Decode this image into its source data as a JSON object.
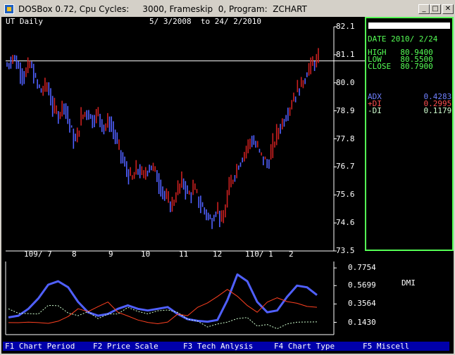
{
  "window": {
    "title": "DOSBox 0.72, Cpu Cycles:     3000, Frameskip  0, Program:  ZCHART",
    "buttons": {
      "minimize": "_",
      "maximize": "□",
      "close": "✕"
    }
  },
  "chart_header": {
    "symbol": "UT Daily",
    "range": "5/ 3/2008  to 24/ 2/2010"
  },
  "info_panel": {
    "date": "DATE 2010/ 2/24",
    "high": "HIGH   80.9400",
    "low": "LOW    80.5500",
    "close": "CLOSE  80.7900",
    "adx": "ADX         0.4283",
    "pdi": "+DI         0.2995",
    "mdi": "-DI         0.1179"
  },
  "colors": {
    "up": "#cc2020",
    "down": "#5060ff",
    "adx": "#5060ff",
    "pdi": "#ff4020",
    "mdi": "#d0ffd0",
    "panel_border": "#55ff55"
  },
  "chart_data": [
    {
      "type": "candlestick",
      "title": "UT Daily",
      "x_range": [
        "2008-03-05",
        "2010-02-24"
      ],
      "x_tick_labels": [
        "109/ 7",
        "8",
        "9",
        "10",
        "11",
        "12",
        "110/ 1",
        "2"
      ],
      "y_tick_labels": [
        "82.1",
        "81.1",
        "80.0",
        "78.9",
        "77.8",
        "76.7",
        "75.6",
        "74.6",
        "73.5"
      ],
      "ylim": [
        73.5,
        82.1
      ],
      "reference_line": 80.79,
      "close_path": [
        [
          0,
          80.6
        ],
        [
          3,
          81.0
        ],
        [
          6,
          80.5
        ],
        [
          9,
          80.2
        ],
        [
          12,
          80.7
        ],
        [
          15,
          80.0
        ],
        [
          18,
          79.6
        ],
        [
          21,
          79.9
        ],
        [
          24,
          79.0
        ],
        [
          27,
          78.7
        ],
        [
          30,
          79.2
        ],
        [
          33,
          78.3
        ],
        [
          36,
          77.6
        ],
        [
          39,
          78.6
        ],
        [
          42,
          78.9
        ],
        [
          45,
          78.5
        ],
        [
          48,
          78.8
        ],
        [
          51,
          78.2
        ],
        [
          54,
          78.5
        ],
        [
          57,
          77.9
        ],
        [
          60,
          77.2
        ],
        [
          63,
          76.6
        ],
        [
          66,
          76.2
        ],
        [
          69,
          76.7
        ],
        [
          72,
          76.3
        ],
        [
          75,
          76.8
        ],
        [
          78,
          76.6
        ],
        [
          81,
          76.0
        ],
        [
          84,
          75.5
        ],
        [
          87,
          75.2
        ],
        [
          90,
          75.8
        ],
        [
          93,
          76.2
        ],
        [
          96,
          75.6
        ],
        [
          99,
          75.9
        ],
        [
          102,
          75.3
        ],
        [
          105,
          75.0
        ],
        [
          108,
          74.6
        ],
        [
          111,
          75.2
        ],
        [
          114,
          74.5
        ],
        [
          117,
          75.8
        ],
        [
          120,
          76.4
        ],
        [
          123,
          76.9
        ],
        [
          126,
          77.3
        ],
        [
          129,
          77.8
        ],
        [
          132,
          77.5
        ],
        [
          135,
          77.1
        ],
        [
          138,
          76.8
        ],
        [
          141,
          77.6
        ],
        [
          144,
          78.2
        ],
        [
          147,
          78.6
        ],
        [
          150,
          79.1
        ],
        [
          153,
          79.6
        ],
        [
          156,
          79.9
        ],
        [
          159,
          80.4
        ],
        [
          162,
          80.7
        ],
        [
          165,
          80.8
        ]
      ]
    },
    {
      "type": "line",
      "title": "DMI",
      "y_tick_labels": [
        "0.7754",
        "0.5699",
        "0.3564",
        "0.1430"
      ],
      "ylim": [
        0.0,
        0.85
      ],
      "series": [
        {
          "name": "ADX",
          "values": [
            0.2,
            0.22,
            0.3,
            0.42,
            0.58,
            0.62,
            0.55,
            0.38,
            0.26,
            0.22,
            0.24,
            0.3,
            0.34,
            0.3,
            0.28,
            0.3,
            0.32,
            0.24,
            0.18,
            0.16,
            0.15,
            0.17,
            0.4,
            0.7,
            0.62,
            0.38,
            0.26,
            0.28,
            0.44,
            0.57,
            0.55,
            0.46
          ]
        },
        {
          "name": "+DI",
          "values": [
            0.14,
            0.13,
            0.16,
            0.12,
            0.15,
            0.14,
            0.22,
            0.3,
            0.26,
            0.34,
            0.36,
            0.28,
            0.2,
            0.18,
            0.14,
            0.12,
            0.16,
            0.22,
            0.24,
            0.3,
            0.38,
            0.44,
            0.52,
            0.46,
            0.32,
            0.28,
            0.36,
            0.44,
            0.38,
            0.36,
            0.34,
            0.3
          ]
        },
        {
          "name": "-DI",
          "values": [
            0.3,
            0.24,
            0.26,
            0.22,
            0.36,
            0.32,
            0.26,
            0.22,
            0.26,
            0.2,
            0.22,
            0.26,
            0.3,
            0.28,
            0.24,
            0.27,
            0.3,
            0.24,
            0.2,
            0.14,
            0.1,
            0.12,
            0.14,
            0.2,
            0.18,
            0.12,
            0.1,
            0.08,
            0.12,
            0.14,
            0.16,
            0.13
          ]
        }
      ]
    }
  ],
  "function_keys": [
    "F1 Chart Period",
    "F2 Price Scale",
    "F3 Tech Anlysis",
    "F4 Chart Type",
    "F5 Miscell"
  ]
}
